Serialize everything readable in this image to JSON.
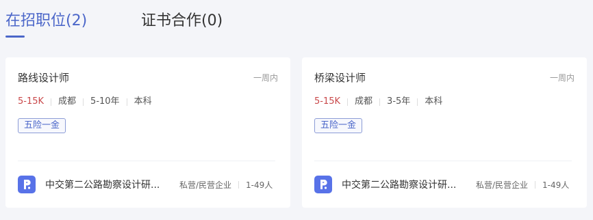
{
  "tabs": [
    {
      "label": "在招职位(2)",
      "active": true
    },
    {
      "label": "证书合作(0)",
      "active": false
    }
  ],
  "jobs": [
    {
      "title": "路线设计师",
      "posted": "一周内",
      "salary": "5-15K",
      "city": "成都",
      "experience": "5-10年",
      "education": "本科",
      "tag": "五险一金",
      "company": {
        "name": "中交第二公路勘察设计研...",
        "type": "私营/民营企业",
        "size": "1-49人",
        "logo_icon": "company-logo-icon"
      }
    },
    {
      "title": "桥梁设计师",
      "posted": "一周内",
      "salary": "5-15K",
      "city": "成都",
      "experience": "3-5年",
      "education": "本科",
      "tag": "五险一金",
      "company": {
        "name": "中交第二公路勘察设计研...",
        "type": "私营/民营企业",
        "size": "1-49人",
        "logo_icon": "company-logo-icon"
      }
    }
  ],
  "colors": {
    "accent": "#4b66c9",
    "salary": "#c9484a",
    "logo_bg": "#5872e8",
    "page_bg": "#f4f5f9"
  }
}
